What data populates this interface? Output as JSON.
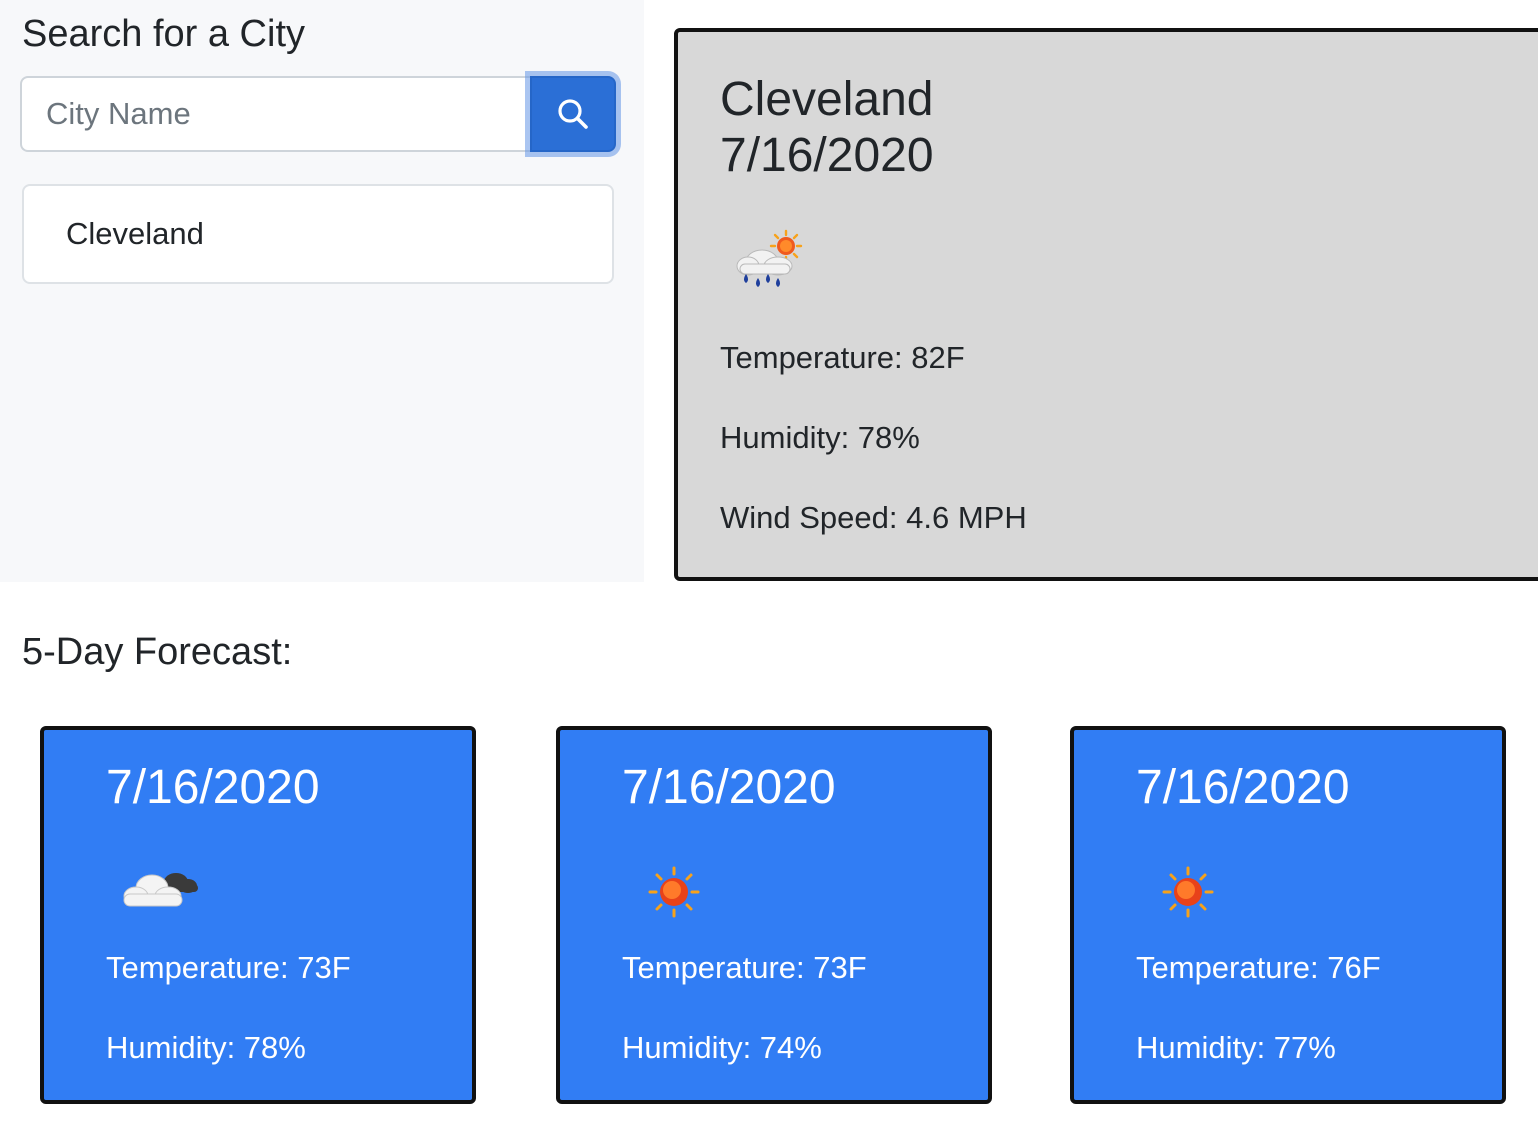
{
  "sidebar": {
    "title": "Search for a City",
    "search": {
      "placeholder": "City Name",
      "value": ""
    },
    "search_button_icon": "search-icon",
    "history": [
      {
        "label": "Cleveland"
      }
    ]
  },
  "current": {
    "city": "Cleveland",
    "date": "7/16/2020",
    "icon": "rain-sun-icon",
    "temperature": "Temperature: 82F",
    "humidity": "Humidity: 78%",
    "wind": "Wind Speed: 4.6 MPH"
  },
  "forecast": {
    "title": "5-Day Forecast:",
    "days": [
      {
        "date": "7/16/2020",
        "icon": "cloudy-icon",
        "temperature": "Temperature: 73F",
        "humidity": "Humidity: 78%"
      },
      {
        "date": "7/16/2020",
        "icon": "sun-icon",
        "temperature": "Temperature: 73F",
        "humidity": "Humidity: 74%"
      },
      {
        "date": "7/16/2020",
        "icon": "sun-icon",
        "temperature": "Temperature: 76F",
        "humidity": "Humidity: 77%"
      }
    ]
  },
  "colors": {
    "accent_button": "#2b6fd6",
    "forecast_card_bg": "#317df4",
    "current_card_bg": "#d8d8d8",
    "sidebar_bg": "#f7f8fa"
  }
}
